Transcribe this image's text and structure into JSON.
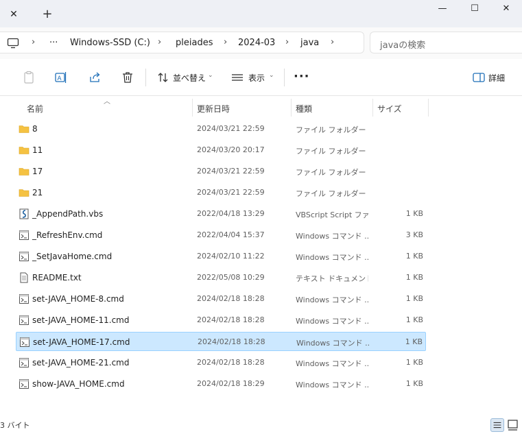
{
  "titlebar": {
    "tab_close": "✕",
    "new_tab": "+",
    "minimize": "—",
    "maximize": "☐",
    "close": "✕"
  },
  "address": {
    "more": "···",
    "crumbs": [
      "Windows-SSD (C:)",
      "pleiades",
      "2024-03",
      "java"
    ],
    "separator": "›"
  },
  "search": {
    "placeholder": "javaの検索"
  },
  "commandbar": {
    "sort_label": "並べ替え",
    "view_label": "表示",
    "more": "···",
    "details_label": "詳細"
  },
  "columns": {
    "name": "名前",
    "modified": "更新日時",
    "type": "種類",
    "size": "サイズ"
  },
  "files": [
    {
      "name": "8",
      "date": "2024/03/21 22:59",
      "type": "ファイル フォルダー",
      "size": "",
      "icon": "folder"
    },
    {
      "name": "11",
      "date": "2024/03/20 20:17",
      "type": "ファイル フォルダー",
      "size": "",
      "icon": "folder"
    },
    {
      "name": "17",
      "date": "2024/03/21 22:59",
      "type": "ファイル フォルダー",
      "size": "",
      "icon": "folder"
    },
    {
      "name": "21",
      "date": "2024/03/21 22:59",
      "type": "ファイル フォルダー",
      "size": "",
      "icon": "folder"
    },
    {
      "name": "_AppendPath.vbs",
      "date": "2022/04/18 13:29",
      "type": "VBScript Script ファ...",
      "size": "1 KB",
      "icon": "vbs"
    },
    {
      "name": "_RefreshEnv.cmd",
      "date": "2022/04/04 15:37",
      "type": "Windows コマンド ...",
      "size": "3 KB",
      "icon": "cmd"
    },
    {
      "name": "_SetJavaHome.cmd",
      "date": "2024/02/10 11:22",
      "type": "Windows コマンド ...",
      "size": "1 KB",
      "icon": "cmd"
    },
    {
      "name": "README.txt",
      "date": "2022/05/08 10:29",
      "type": "テキスト ドキュメント",
      "size": "1 KB",
      "icon": "txt"
    },
    {
      "name": "set-JAVA_HOME-8.cmd",
      "date": "2024/02/18 18:28",
      "type": "Windows コマンド ...",
      "size": "1 KB",
      "icon": "cmd"
    },
    {
      "name": "set-JAVA_HOME-11.cmd",
      "date": "2024/02/18 18:28",
      "type": "Windows コマンド ...",
      "size": "1 KB",
      "icon": "cmd"
    },
    {
      "name": "set-JAVA_HOME-17.cmd",
      "date": "2024/02/18 18:28",
      "type": "Windows コマンド ...",
      "size": "1 KB",
      "icon": "cmd",
      "selected": true
    },
    {
      "name": "set-JAVA_HOME-21.cmd",
      "date": "2024/02/18 18:28",
      "type": "Windows コマンド ...",
      "size": "1 KB",
      "icon": "cmd"
    },
    {
      "name": "show-JAVA_HOME.cmd",
      "date": "2024/02/18 18:29",
      "type": "Windows コマンド ...",
      "size": "1 KB",
      "icon": "cmd"
    }
  ],
  "status": {
    "text": "3 バイト"
  },
  "colors": {
    "selected_bg": "#cce8ff",
    "selected_border": "#99d1ff",
    "folder": "#f5c242"
  }
}
